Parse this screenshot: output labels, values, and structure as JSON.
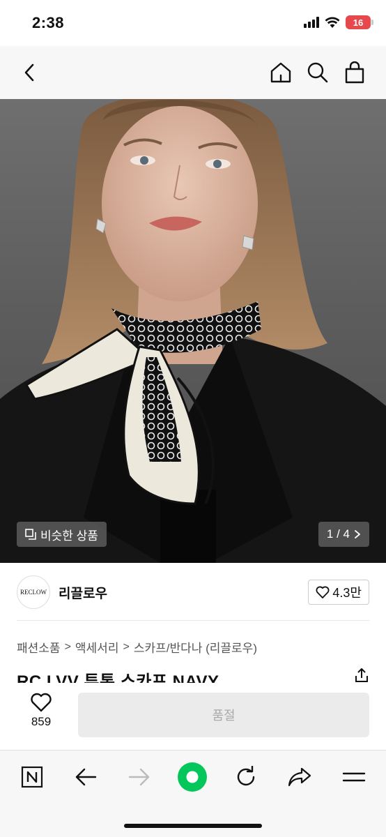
{
  "status": {
    "time": "2:38",
    "battery": "16"
  },
  "product": {
    "similar_label": "비슷한 상품",
    "page_counter": "1 / 4",
    "seller_logo_text": "RECLOW",
    "seller_name": "리끌로우",
    "likes": "4.3만",
    "breadcrumb": [
      "패션소품",
      "액세서리",
      "스카프/반다나 (리끌로우)"
    ],
    "title": "RC LVV 투톤 스카프 NAVY"
  },
  "purchase": {
    "wish_count": "859",
    "soldout_label": "품절"
  },
  "icons": {
    "back": "chevron-left-icon",
    "home": "home-icon",
    "search": "search-icon",
    "cart": "shopping-bag-icon",
    "share": "share-icon",
    "heart": "heart-icon"
  },
  "colors": {
    "accent_green": "#03c75a",
    "battery_red": "#e5484d"
  }
}
